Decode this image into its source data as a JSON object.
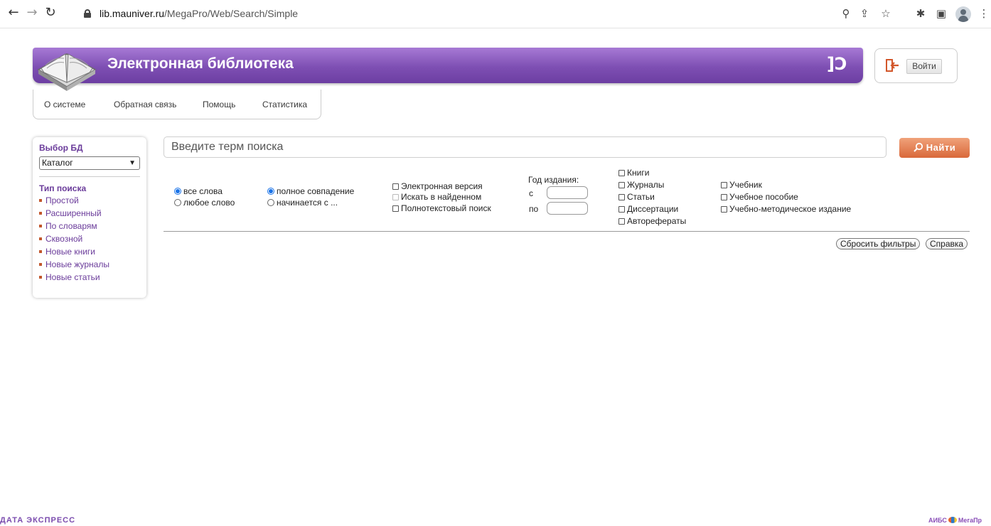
{
  "browser": {
    "url_domain": "lib.mauniver.ru",
    "url_path": "/MegaPro/Web/Search/Simple",
    "back_icon": "back-arrow-icon",
    "forward_icon": "forward-arrow-icon",
    "reload_icon": "reload-icon"
  },
  "header": {
    "title": "Электронная библиотека",
    "brand_mark": "]Ↄ",
    "login_label": "Войти"
  },
  "menu": {
    "items": [
      "О системе",
      "Обратная связь",
      "Помощь",
      "Статистика"
    ]
  },
  "sidebar": {
    "db_title": "Выбор БД",
    "db_selected": "Каталог",
    "search_type_title": "Тип поиска",
    "links": [
      "Простой",
      "Расширенный",
      "По словарям",
      "Сквозной",
      "Новые книги",
      "Новые журналы",
      "Новые статьи"
    ]
  },
  "search": {
    "placeholder": "Введите терм поиска",
    "button_label": "Найти",
    "word_modes": [
      {
        "label": "все слова",
        "checked": true
      },
      {
        "label": "любое слово",
        "checked": false
      }
    ],
    "match_modes": [
      {
        "label": "полное совпадение",
        "checked": true
      },
      {
        "label": "начинается с ...",
        "checked": false
      }
    ],
    "options": [
      "Электронная версия",
      "Искать в найденном",
      "Полнотекстовый поиск"
    ],
    "year_label": "Год издания:",
    "year_from": "с",
    "year_to": "по",
    "types_col1": [
      "Книги",
      "Журналы",
      "Статьи",
      "Диссертации",
      "Авторефераты"
    ],
    "types_col2": [
      "Учебник",
      "Учебное пособие",
      "Учебно-методическое издание"
    ],
    "reset_label": "Сбросить фильтры",
    "help_label": "Справка"
  },
  "footer": {
    "left_logo": "ДАТА ЭКСПРЕСС",
    "right_logo_a": "АИБС",
    "right_logo_b": "МегаПр"
  }
}
